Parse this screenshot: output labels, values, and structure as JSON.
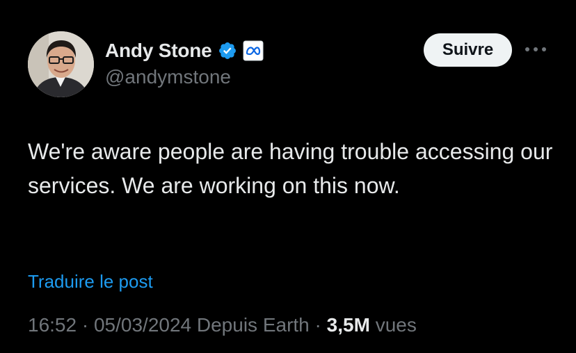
{
  "author": {
    "display_name": "Andy Stone",
    "handle": "@andymstone",
    "verified_icon": "verified-badge-icon",
    "affiliation_icon": "meta-logo-icon"
  },
  "actions": {
    "follow_label": "Suivre",
    "more_icon": "more-horizontal-icon"
  },
  "post": {
    "text": "We're aware people are having trouble accessing our services. We are working on this now.",
    "translate_label": "Traduire le post"
  },
  "meta": {
    "time": "16:52",
    "separator": "·",
    "date": "05/03/2024",
    "source": "Depuis Earth",
    "views_count": "3,5M",
    "views_label": "vues"
  },
  "colors": {
    "background": "#000000",
    "primary_text": "#e7e9ea",
    "secondary_text": "#71767b",
    "link": "#1d9bf0",
    "button_bg": "#eff3f4",
    "verified": "#1d9bf0"
  }
}
